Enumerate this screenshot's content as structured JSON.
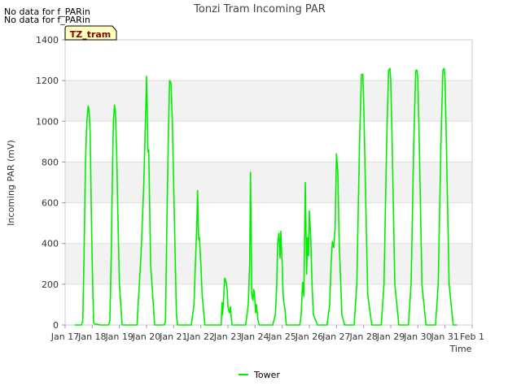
{
  "notes": [
    "No data for f_PARin",
    "No data for f_PARin"
  ],
  "badge": "TZ_tram",
  "colors": {
    "series": "#00ee00",
    "band": "#f2f2f2",
    "grid": "#dddddd",
    "badge_bg": "#ffffc0"
  },
  "chart_data": {
    "type": "line",
    "title": "Tonzi Tram Incoming PAR",
    "xlabel": "Time",
    "ylabel": "Incoming PAR (mV)",
    "xlim": [
      0,
      15
    ],
    "ylim": [
      0,
      1400
    ],
    "y_ticks": [
      0,
      200,
      400,
      600,
      800,
      1000,
      1200,
      1400
    ],
    "x_ticks": [
      "Jan 17",
      "Jan 18",
      "Jan 19",
      "Jan 20",
      "Jan 21",
      "Jan 22",
      "Jan 23",
      "Jan 24",
      "Jan 25",
      "Jan 26",
      "Jan 27",
      "Jan 28",
      "Jan 29",
      "Jan 30",
      "Jan 31",
      "Feb 1"
    ],
    "x_unit": "days since Jan 17",
    "grid": true,
    "legend_position": "bottom-center",
    "series": [
      {
        "name": "Tower",
        "x": [
          0.35,
          0.6,
          0.65,
          0.7,
          0.75,
          0.8,
          0.85,
          0.88,
          0.92,
          0.96,
          1.0,
          1.05,
          1.1,
          1.3,
          1.35,
          1.6,
          1.65,
          1.7,
          1.75,
          1.78,
          1.82,
          1.85,
          1.9,
          1.95,
          2.0,
          2.1,
          2.15,
          2.3,
          2.65,
          2.8,
          2.9,
          2.95,
          2.97,
          2.99,
          3.0,
          3.02,
          3.05,
          3.08,
          3.15,
          3.3,
          3.65,
          3.7,
          3.75,
          3.8,
          3.85,
          3.9,
          3.95,
          4.0,
          4.1,
          4.15,
          4.3,
          4.65,
          4.75,
          4.8,
          4.85,
          4.88,
          4.92,
          4.95,
          5.0,
          5.05,
          5.15,
          5.3,
          5.65,
          5.75,
          5.78,
          5.8,
          5.83,
          5.88,
          5.9,
          5.95,
          5.98,
          6.0,
          6.05,
          6.1,
          6.12,
          6.15,
          6.3,
          6.65,
          6.75,
          6.8,
          6.83,
          6.88,
          6.92,
          6.95,
          6.98,
          7.02,
          7.05,
          7.1,
          7.15,
          7.3,
          7.65,
          7.75,
          7.8,
          7.83,
          7.88,
          7.92,
          7.95,
          7.98,
          8.0,
          8.02,
          8.05,
          8.1,
          8.15,
          8.3,
          8.65,
          8.7,
          8.75,
          8.8,
          8.85,
          8.9,
          8.93,
          8.97,
          9.0,
          9.05,
          9.1,
          9.15,
          9.3,
          9.65,
          9.75,
          9.8,
          9.85,
          9.9,
          9.95,
          10.0,
          10.05,
          10.1,
          10.2,
          10.3,
          10.65,
          10.75,
          10.85,
          10.92,
          10.97,
          11.0,
          11.05,
          11.15,
          11.3,
          11.35,
          11.65,
          11.75,
          11.85,
          11.92,
          11.97,
          12.0,
          12.05,
          12.15,
          12.3,
          12.35,
          12.65,
          12.75,
          12.85,
          12.92,
          12.97,
          13.0,
          13.05,
          13.15,
          13.3,
          13.35,
          13.65,
          13.75,
          13.85,
          13.92,
          13.97,
          14.0,
          14.05,
          14.15,
          14.3,
          14.45
        ],
        "y": [
          0,
          0,
          20,
          350,
          800,
          1000,
          1075,
          1060,
          950,
          600,
          300,
          10,
          5,
          0,
          0,
          0,
          20,
          350,
          800,
          1000,
          1080,
          1050,
          850,
          500,
          200,
          0,
          0,
          0,
          0,
          350,
          700,
          950,
          1050,
          1150,
          1220,
          1100,
          850,
          860,
          300,
          0,
          0,
          20,
          500,
          900,
          1200,
          1190,
          1000,
          700,
          50,
          0,
          0,
          0,
          100,
          300,
          480,
          660,
          420,
          430,
          300,
          150,
          0,
          0,
          0,
          0,
          110,
          50,
          100,
          230,
          225,
          200,
          160,
          90,
          60,
          90,
          40,
          0,
          0,
          0,
          100,
          300,
          750,
          150,
          120,
          175,
          150,
          60,
          100,
          30,
          0,
          0,
          0,
          50,
          200,
          400,
          450,
          330,
          460,
          350,
          300,
          200,
          120,
          80,
          0,
          0,
          0,
          50,
          210,
          140,
          700,
          250,
          430,
          340,
          560,
          430,
          200,
          50,
          0,
          0,
          100,
          300,
          410,
          380,
          480,
          840,
          750,
          400,
          50,
          0,
          0,
          200,
          900,
          1230,
          1230,
          1100,
          800,
          150,
          0,
          0,
          0,
          200,
          900,
          1250,
          1260,
          1200,
          900,
          200,
          0,
          0,
          0,
          200,
          900,
          1250,
          1250,
          1200,
          900,
          200,
          0,
          0,
          0,
          200,
          900,
          1250,
          1260,
          1200,
          900,
          200,
          0,
          0
        ]
      }
    ]
  }
}
